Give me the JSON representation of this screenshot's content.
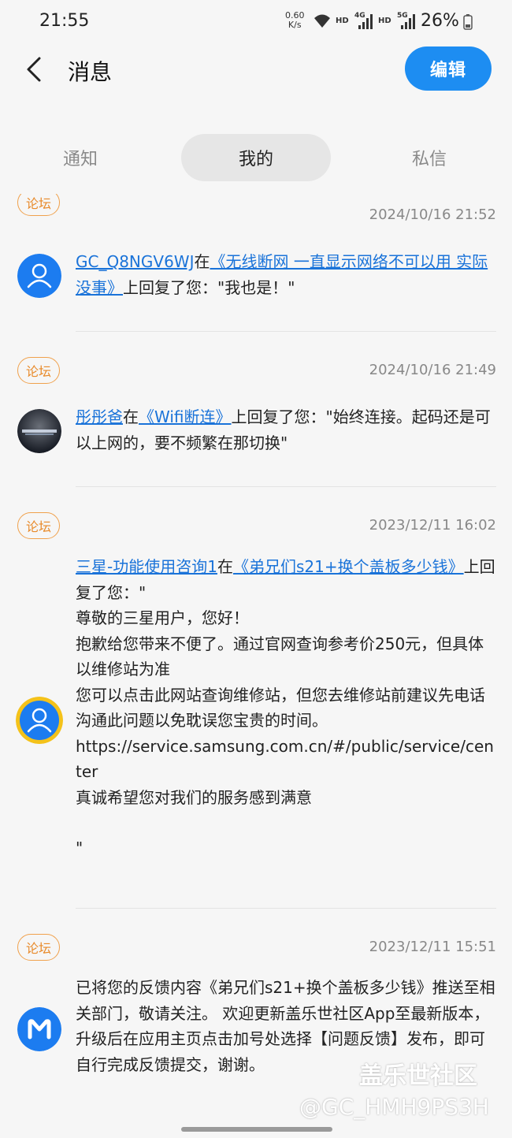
{
  "status": {
    "time": "21:55",
    "netspeed_value": "0.60",
    "netspeed_unit": "K/s",
    "hd1": "HD",
    "net1": "4G",
    "hd2": "HD",
    "net2": "5G",
    "battery": "26%"
  },
  "header": {
    "title": "消息",
    "edit_label": "编辑"
  },
  "tabs": [
    {
      "label": "通知",
      "active": false
    },
    {
      "label": "我的",
      "active": true
    },
    {
      "label": "私信",
      "active": false
    }
  ],
  "messages": [
    {
      "badge": "论坛",
      "date": "2024/10/16 21:52",
      "user": "GC_Q8NGV6WJ",
      "connector": "在",
      "topic": "《无线断网 一直显示网络不可以用 实际没事》",
      "suffix": "上回复了您：\"我也是！\""
    },
    {
      "badge": "论坛",
      "date": "2024/10/16 21:49",
      "user": "彤彤爸",
      "connector": "在",
      "topic": "《Wifi断连》",
      "suffix": "上回复了您：\"始终连接。起码还是可以上网的，要不频繁在那切换\""
    },
    {
      "badge": "论坛",
      "date": "2023/12/11 16:02",
      "user": "三星-功能使用咨询1",
      "connector": "在",
      "topic": "《弟兄们s21+换个盖板多少钱》",
      "suffix": "上回复了您：\"",
      "lines": [
        "尊敬的三星用户，您好！",
        "抱歉给您带来不便了。通过官网查询参考价250元，但具体以维修站为准",
        "您可以点击此网站查询维修站，但您去维修站前建议先电话沟通此问题以免耽误您宝贵的时间。",
        "https://service.samsung.com.cn/#/public/service/center",
        "真诚希望您对我们的服务感到满意",
        "",
        "\""
      ]
    },
    {
      "badge": "论坛",
      "date": "2023/12/11 15:51",
      "text": "已将您的反馈内容《弟兄们s21+换个盖板多少钱》推送至相关部门，敬请关注。 欢迎更新盖乐世社区App至最新版本，升级后在应用主页点击加号处选择【问题反馈】发布，即可自行完成反馈提交，谢谢。"
    }
  ],
  "watermark": {
    "line1": "盖乐世社区",
    "line2": "@GC_HMH9PS3H"
  },
  "colors": {
    "accent": "#1d8df2",
    "link": "#1a73d9",
    "badge": "#f0a14c"
  }
}
